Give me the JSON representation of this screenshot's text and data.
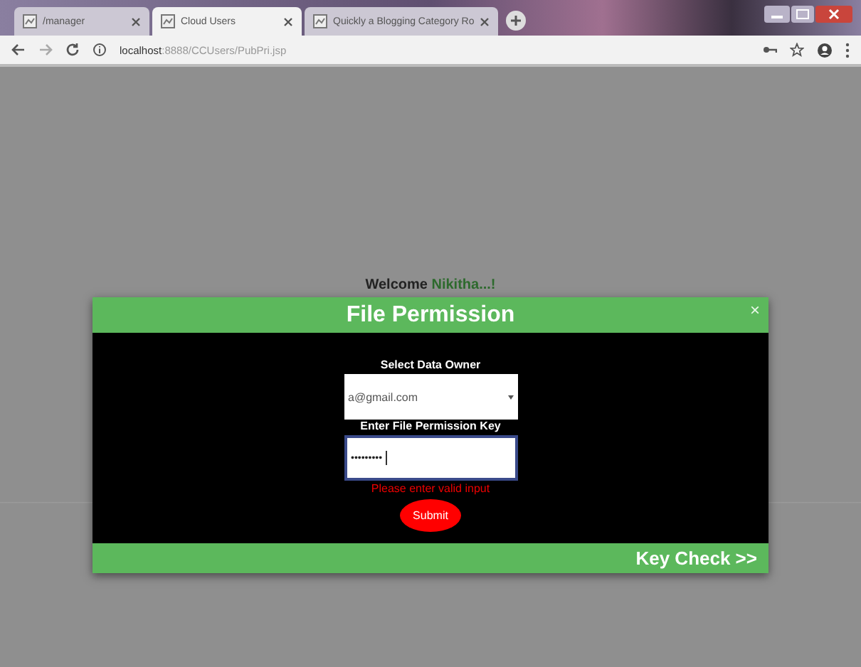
{
  "browser": {
    "tabs": [
      {
        "title": "/manager",
        "selected": false
      },
      {
        "title": "Cloud Users",
        "selected": true
      },
      {
        "title": "Quickly a Blogging Category Ro",
        "selected": false
      }
    ],
    "address": {
      "host": "localhost",
      "path": ":8888/CCUsers/PubPri.jsp"
    }
  },
  "page": {
    "welcome": "Welcome",
    "user": "Nikitha...!"
  },
  "modal": {
    "title": "File Permission",
    "close": "×",
    "fields": [
      {
        "kind": "select",
        "label": "Select Data Owner",
        "value": "a@gmail.com"
      },
      {
        "kind": "password",
        "label": "Enter File Permission Key",
        "value": "•••••••••"
      }
    ],
    "error": "Please enter valid input",
    "submit": "Submit",
    "footer_link": "Key Check >>"
  }
}
